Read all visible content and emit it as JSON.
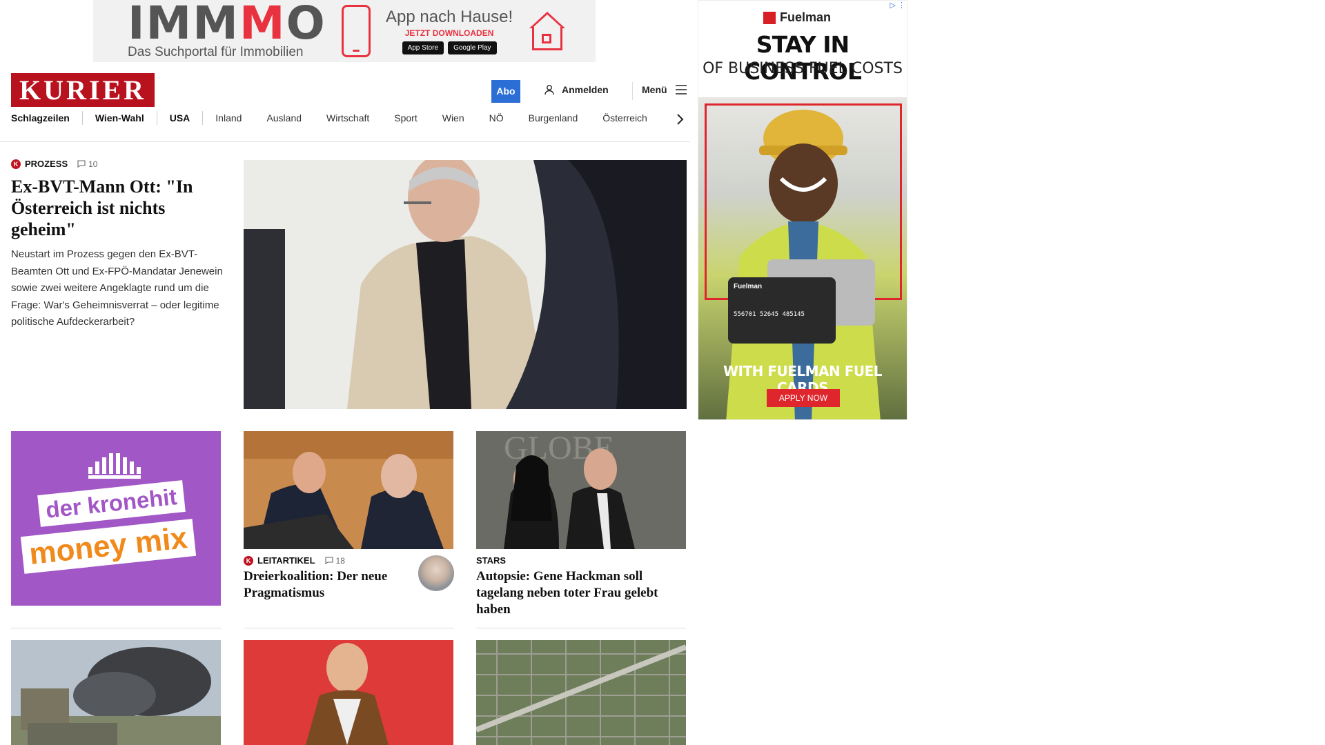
{
  "top_ad": {
    "logo_part1": "IMM",
    "logo_part2": "M",
    "logo_part3": "O",
    "tagline": "Das Suchportal für Immobilien",
    "headline": "App nach Hause!",
    "cta": "JETZT DOWNLOADEN",
    "store1": "App Store",
    "store2": "Google Play"
  },
  "header": {
    "logo": "KURIER",
    "abo_label": "Abo",
    "login_label": "Anmelden",
    "menu_label": "Menü"
  },
  "nav": {
    "items": [
      "Schlagzeilen",
      "Wien-Wahl",
      "USA",
      "Inland",
      "Ausland",
      "Wirtschaft",
      "Sport",
      "Wien",
      "NÖ",
      "Burgenland",
      "Österreich"
    ]
  },
  "lead": {
    "kicker": "PROZESS",
    "comments": "10",
    "title": "Ex-BVT-Mann Ott: \"In Österreich ist nichts geheim\"",
    "teaser": "Neustart im Prozess gegen den Ex-BVT-Beamten Ott und Ex-FPÖ-Mandatar Jenewein sowie zwei weitere Angeklagte rund um die Frage: War's Geheimnisverrat – oder legitime politische Aufdeckerarbeit?"
  },
  "right_ad": {
    "brand": "Fuelman",
    "headline": "STAY IN CONTROL",
    "subhead": "OF BUSINESS FUEL COSTS",
    "card_brand": "Fuelman",
    "card_number": "556701 52645 485145",
    "bottom": "WITH FUELMAN FUEL CARDS",
    "cta": "APPLY NOW"
  },
  "promo_ad": {
    "line1": "der kronehit",
    "line2": "money mix"
  },
  "articles": [
    {
      "kicker": "LEITARTIKEL",
      "comments": "18",
      "title": "Dreierkoalition: Der neue Pragmatismus"
    },
    {
      "kicker": "STARS",
      "title": "Autopsie: Gene Hackman soll tagelang neben toter Frau gelebt haben"
    }
  ],
  "colors": {
    "kurier_red": "#b8121f",
    "abo_blue": "#2b6ed5",
    "fuelman_red": "#e0262d",
    "kronehit_purple": "#a257c6"
  }
}
